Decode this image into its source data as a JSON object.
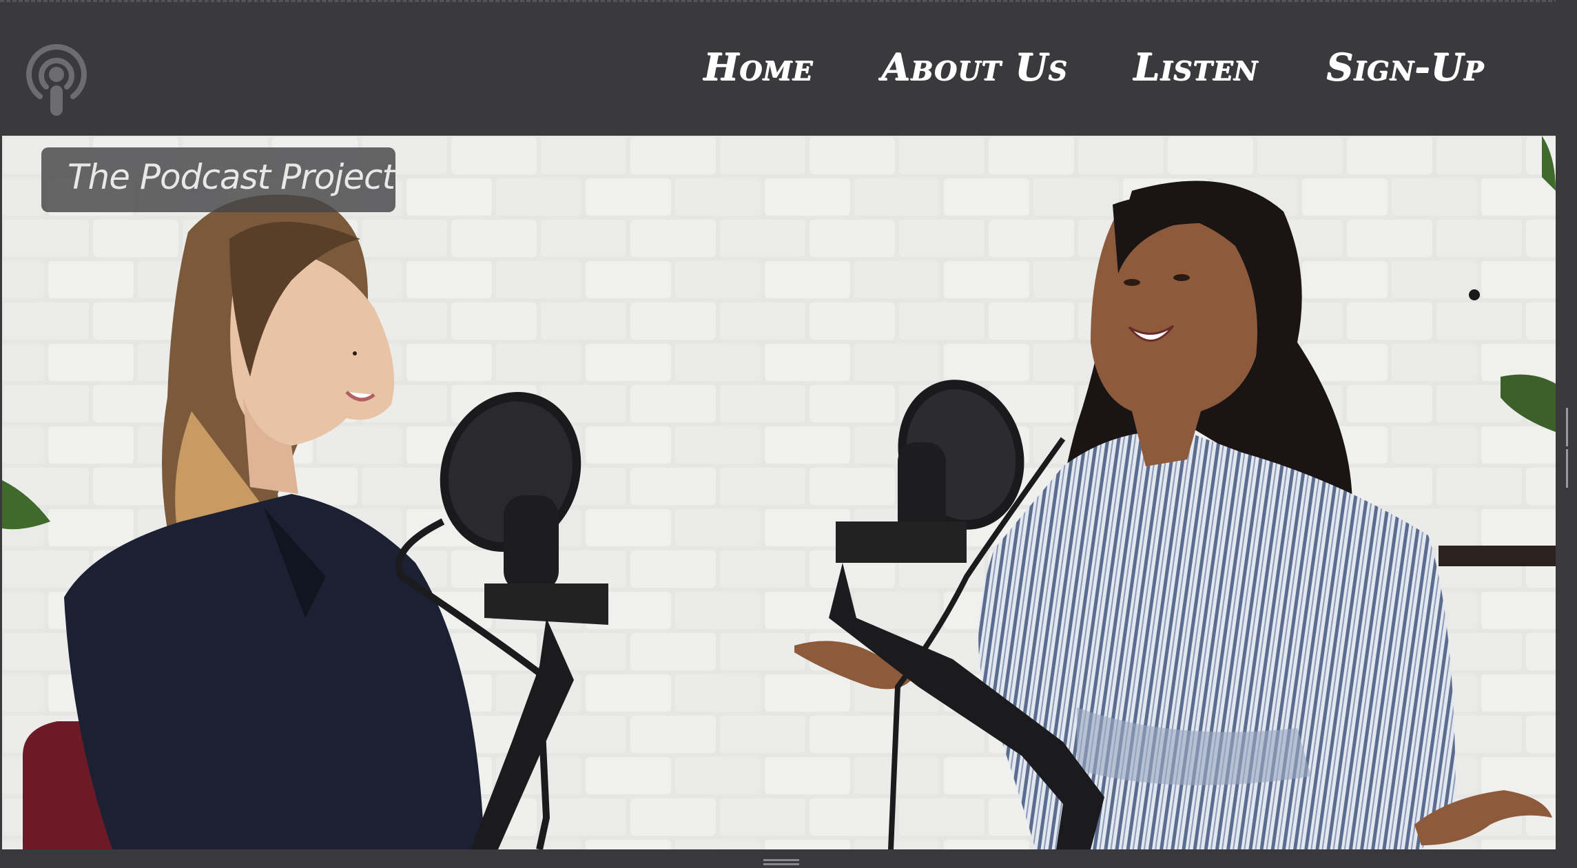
{
  "header": {
    "logo_icon": "podcast-icon",
    "nav": [
      {
        "label": "Home"
      },
      {
        "label": "About Us"
      },
      {
        "label": "Listen"
      },
      {
        "label": "Sign-Up"
      }
    ]
  },
  "hero": {
    "title": "The Podcast Project",
    "image_icon": "podcast-studio-photo"
  },
  "colors": {
    "header_bg": "#3a393c",
    "nav_text": "#ffffff",
    "badge_bg": "#464648"
  }
}
